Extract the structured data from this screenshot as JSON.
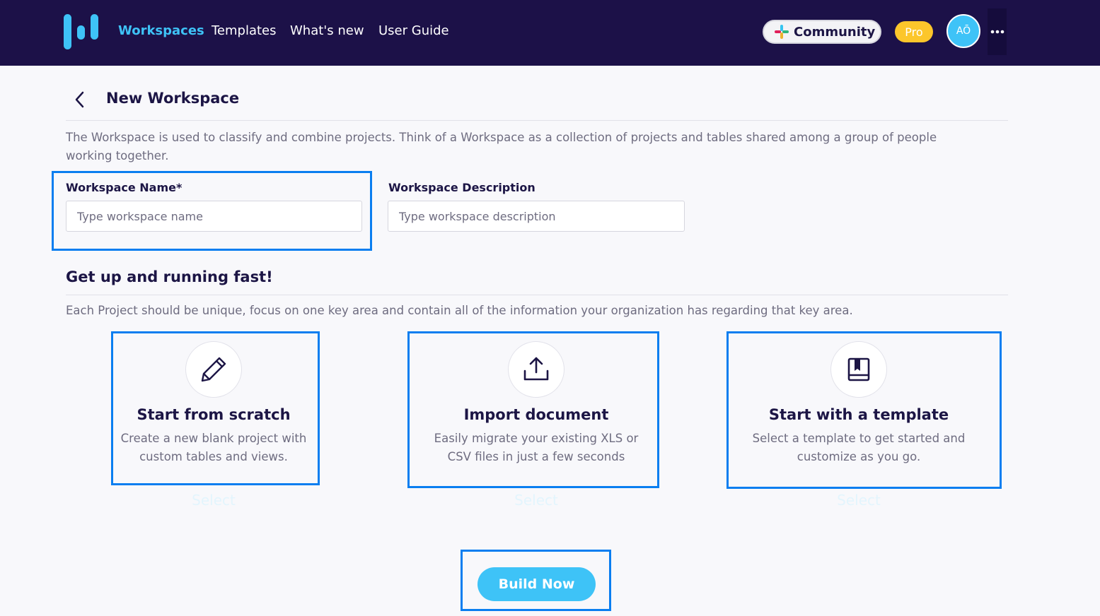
{
  "nav": {
    "items": [
      {
        "label": "Workspaces",
        "active": true
      },
      {
        "label": "Templates",
        "active": false
      },
      {
        "label": "What's new",
        "active": false
      },
      {
        "label": "User Guide",
        "active": false
      }
    ],
    "community_label": "Community",
    "community_icon": "slack-icon",
    "plan_badge": "Pro",
    "avatar_initials": "AŌ",
    "more_icon": "more-horizontal-icon"
  },
  "page": {
    "title": "New Workspace",
    "back_icon": "chevron-left-icon",
    "description": "The Workspace is used to classify and combine projects. Think of a Workspace as a collection of projects and tables shared among a group of people working together."
  },
  "form": {
    "name_label": "Workspace Name*",
    "name_placeholder": "Type workspace name",
    "description_label": "Workspace Description",
    "description_placeholder": "Type workspace description"
  },
  "quickstart": {
    "title": "Get up and running fast!",
    "description": "Each Project should be unique, focus on one key area and contain all of the information your organization has regarding that key area.",
    "cards": [
      {
        "icon": "pencil-icon",
        "title": "Start from scratch",
        "text": "Create a new blank project with custom tables and views.",
        "select_label": "Select"
      },
      {
        "icon": "upload-icon",
        "title": "Import document",
        "text": "Easily migrate your existing XLS or CSV files in just a few seconds",
        "select_label": "Select"
      },
      {
        "icon": "book-icon",
        "title": "Start with a template",
        "text": "Select a template to get started and customize as you go.",
        "select_label": "Select"
      }
    ]
  },
  "actions": {
    "build_label": "Build Now"
  },
  "colors": {
    "topbar": "#1c1148",
    "accent": "#3ec3f7",
    "pro": "#fcc62b",
    "highlight": "#0a7ef0"
  }
}
